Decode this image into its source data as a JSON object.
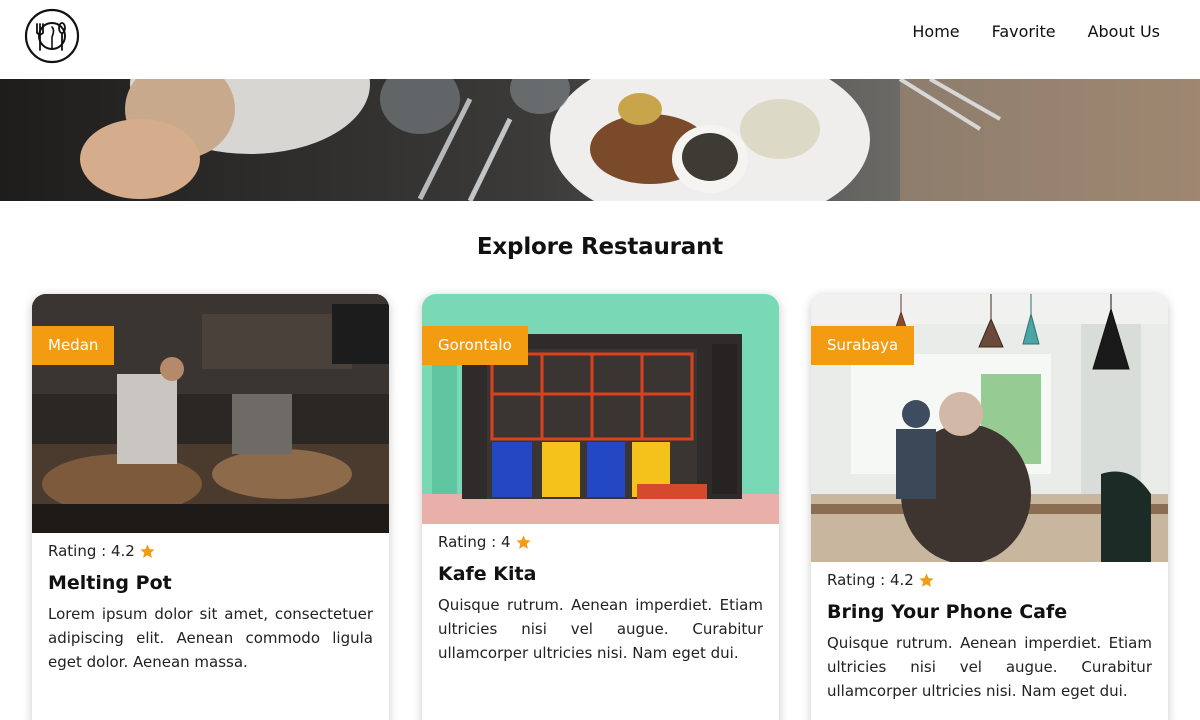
{
  "header": {
    "logo_icon": "cutlery-plate-icon",
    "nav": [
      {
        "label": "Home"
      },
      {
        "label": "Favorite"
      },
      {
        "label": "About Us"
      }
    ]
  },
  "hero": {
    "image": "dining-table-with-food-photo"
  },
  "section": {
    "title": "Explore Restaurant"
  },
  "colors": {
    "accent": "#f39c12",
    "star": "#f39c12",
    "text": "#111111"
  },
  "restaurants": [
    {
      "city": "Medan",
      "rating_label": "Rating : 4.2",
      "rating": 4.2,
      "name": "Melting Pot",
      "description": "Lorem ipsum dolor sit amet, consectetuer adipiscing elit. Aenean commodo ligula eget dolor. Aenean massa.",
      "image": "busy-cafe-counter-photo"
    },
    {
      "city": "Gorontalo",
      "rating_label": "Rating : 4",
      "rating": 4,
      "name": "Kafe Kita",
      "description": "Quisque rutrum. Aenean imperdiet. Etiam ultricies nisi vel augue. Curabitur ullamcorper ultricies nisi. Nam eget dui.",
      "image": "colorful-storefront-photo"
    },
    {
      "city": "Surabaya",
      "rating_label": "Rating : 4.2",
      "rating": 4.2,
      "name": "Bring Your Phone Cafe",
      "description": "Quisque rutrum. Aenean imperdiet. Etiam ultricies nisi vel augue. Curabitur ullamcorper ultricies nisi. Nam eget dui.",
      "image": "cafe-interior-with-man-photo"
    }
  ]
}
